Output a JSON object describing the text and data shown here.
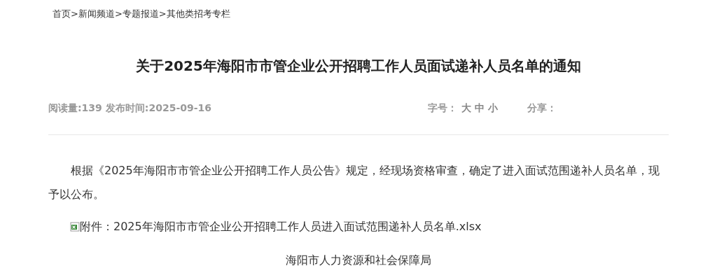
{
  "breadcrumb": {
    "separator": ">",
    "items": [
      {
        "label": "首页"
      },
      {
        "label": "新闻频道"
      },
      {
        "label": "专题报道"
      },
      {
        "label": "其他类招考专栏"
      }
    ]
  },
  "title": "关于2025年海阳市市管企业公开招聘工作人员面试递补人员名单的通知",
  "meta": {
    "views": "阅读量:139",
    "date": "发布时间:2025-09-16",
    "font_size_label": "字号：",
    "font_sizes": [
      "大",
      "中",
      "小"
    ],
    "share_label": "分享："
  },
  "paragraphs": [
    "根据《2025年海阳市市管企业公开招聘工作人员公告》规定，经现场资格审查，确定了进入面试范围递补人员名单，现予以公布。"
  ],
  "attachment": {
    "label": "附件：",
    "file": "2025年海阳市市管企业公开招聘工作人员进入面试范围递补人员名单.xlsx"
  },
  "signature": "海阳市人力资源和社会保障局"
}
